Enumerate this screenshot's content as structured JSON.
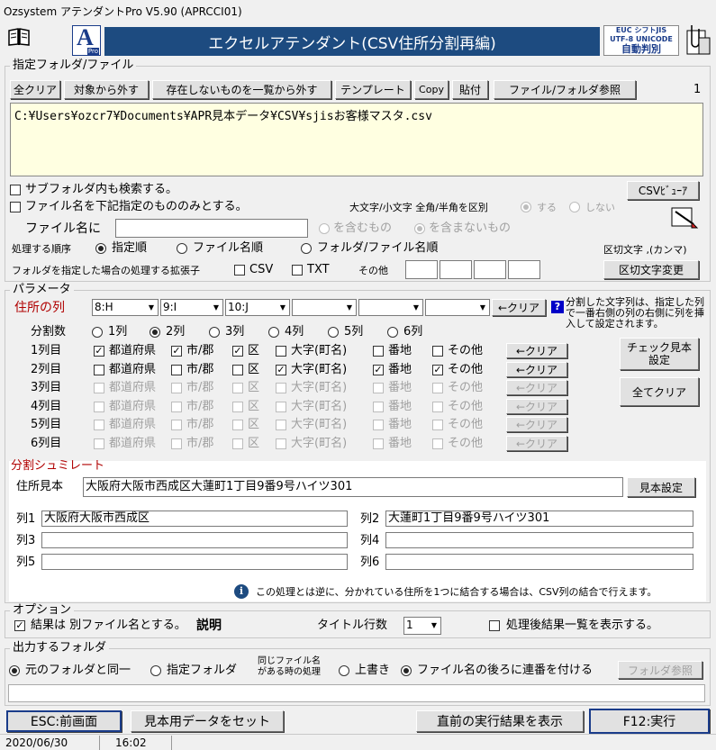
{
  "window": {
    "title": "Ozsystem アテンダントPro V5.90 (APRCCI01)"
  },
  "banner": {
    "title": "エクセルアテンダント(CSV住所分割再編)",
    "logo_letter": "A",
    "logo_sub": "Pro",
    "enc_line1": "EUC  シフトJIS",
    "enc_line2": "UTF-8 UNICODE",
    "enc_line3": "自動判別"
  },
  "folder_group": {
    "title": "指定フォルダ/ファイル",
    "buttons": {
      "clear_all": "全クリア",
      "remove": "対象から外す",
      "remove_missing": "存在しないものを一覧から外す",
      "template": "テンプレート",
      "copy": "Copy",
      "paste": "貼付",
      "browse": "ファイル/フォルダ参照"
    },
    "count": "1",
    "path": "C:¥Users¥ozcr7¥Documents¥APR見本データ¥CSV¥sjisお客様マスタ.csv",
    "subfolder_label": "サブフォルダ内も検索する。",
    "filename_filter_label": "ファイル名を下記指定のもののみとする。",
    "case_label": "大文字/小文字 全角/半角を区別",
    "case_yes": "する",
    "case_no": "しない",
    "csv_viewer": "CSVﾋﾞｭｰｱ",
    "filename_label": "ファイル名に",
    "filename_value": "",
    "contains": "を含むもの",
    "not_contains": "を含まないもの",
    "order_label": "処理する順序",
    "order_specified": "指定順",
    "order_filename": "ファイル名順",
    "order_folder": "フォルダ/ファイル名順",
    "delimiter_label": "区切文字 ,(カンマ)",
    "ext_label": "フォルダを指定した場合の処理する拡張子",
    "ext_csv": "CSV",
    "ext_txt": "TXT",
    "ext_other": "その他",
    "delimiter_change": "区切文字変更"
  },
  "params": {
    "title": "パラメータ",
    "address_col_label": "住所の列",
    "col_selects": [
      "8:H",
      "9:I",
      "10:J",
      "",
      "",
      ""
    ],
    "clear": "←クリア",
    "help": "?",
    "note": "分割した文字列は、指定した列で一番右側の列の右側に列を挿入して設定されます。",
    "split_count_label": "分割数",
    "split_options": [
      "1列",
      "2列",
      "3列",
      "4列",
      "5列",
      "6列"
    ],
    "split_selected": "2列",
    "part_labels": [
      "都道府県",
      "市/郡",
      "区",
      "大字(町名)",
      "番地",
      "その他"
    ],
    "rows": [
      {
        "label": "1列目",
        "checks": [
          true,
          true,
          true,
          false,
          false,
          false
        ],
        "enabled": true
      },
      {
        "label": "2列目",
        "checks": [
          false,
          false,
          false,
          true,
          true,
          true
        ],
        "enabled": true
      },
      {
        "label": "3列目",
        "checks": [
          false,
          false,
          false,
          false,
          false,
          false
        ],
        "enabled": false
      },
      {
        "label": "4列目",
        "checks": [
          false,
          false,
          false,
          false,
          false,
          false
        ],
        "enabled": false
      },
      {
        "label": "5列目",
        "checks": [
          false,
          false,
          false,
          false,
          false,
          false
        ],
        "enabled": false
      },
      {
        "label": "6列目",
        "checks": [
          false,
          false,
          false,
          false,
          false,
          false
        ],
        "enabled": false
      }
    ],
    "check_sample": "チェック見本\n設定",
    "clear_all": "全てクリア"
  },
  "simulate": {
    "title": "分割シュミレート",
    "sample_label": "住所見本",
    "sample_value": "大阪府大阪市西成区大蓮町1丁目9番9号ハイツ301",
    "sample_button": "見本設定",
    "cols": [
      {
        "label": "列1",
        "value": "大阪府大阪市西成区"
      },
      {
        "label": "列2",
        "value": "大蓮町1丁目9番9号ハイツ301"
      },
      {
        "label": "列3",
        "value": ""
      },
      {
        "label": "列4",
        "value": ""
      },
      {
        "label": "列5",
        "value": ""
      },
      {
        "label": "列6",
        "value": ""
      }
    ],
    "info": "この処理とは逆に、分かれている住所を1つに結合する場合は、CSV列の結合で行えます。"
  },
  "options": {
    "title": "オプション",
    "separate_file": "結果は 別ファイル名とする。",
    "explain": "説明",
    "title_rows_label": "タイトル行数",
    "title_rows_value": "1",
    "show_list": "処理後結果一覧を表示する。"
  },
  "output": {
    "title": "出力するフォルダ",
    "same_folder": "元のフォルダと同一",
    "specified_folder": "指定フォルダ",
    "same_name_line1": "同じファイル名",
    "same_name_line2": "がある時の処理",
    "overwrite": "上書き",
    "serial": "ファイル名の後ろに連番を付ける",
    "folder_browse": "フォルダ参照",
    "path": ""
  },
  "footer": {
    "back": "ESC:前画面",
    "set_sample": "見本用データをセット",
    "last_result": "直前の実行結果を表示",
    "run": "F12:実行",
    "date": "2020/06/30",
    "time": "16:02"
  }
}
